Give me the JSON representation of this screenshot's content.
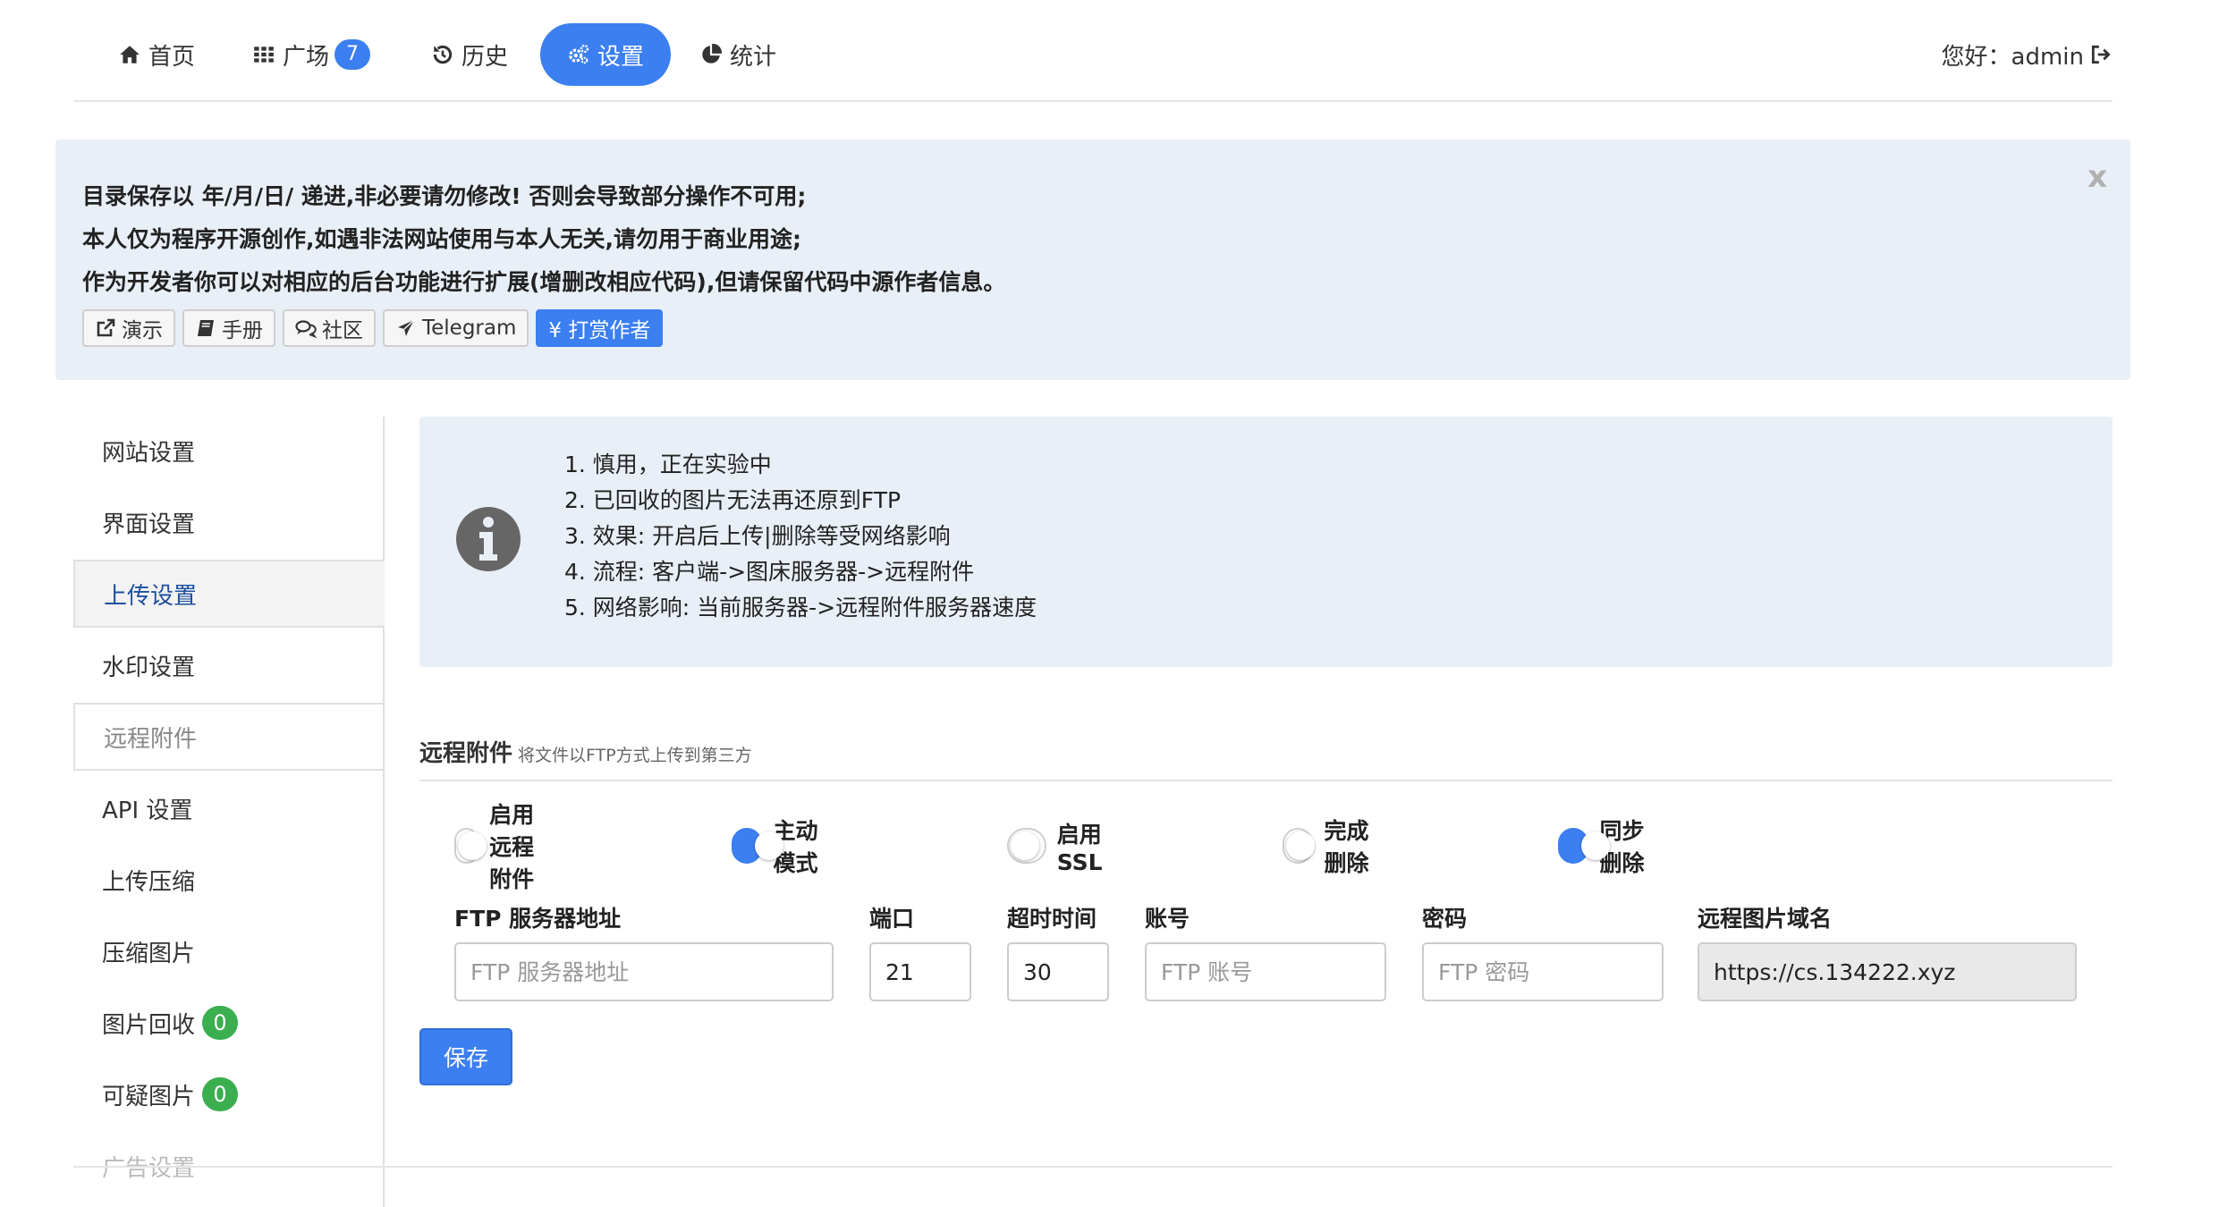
{
  "nav": {
    "items": [
      {
        "label": "首页",
        "icon": "home-icon"
      },
      {
        "label": "广场",
        "icon": "grid-icon",
        "badge": "7"
      },
      {
        "label": "历史",
        "icon": "history-icon"
      },
      {
        "label": "设置",
        "icon": "gears-icon",
        "active": true
      },
      {
        "label": "统计",
        "icon": "pie-chart-icon"
      }
    ],
    "greeting": "您好：admin",
    "accent_color": "#3b7ff0"
  },
  "notice": {
    "lines": [
      "目录保存以 年/月/日/ 递进,非必要请勿修改! 否则会导致部分操作不可用;",
      "本人仅为程序开源创作,如遇非法网站使用与本人无关,请勿用于商业用途;",
      "作为开发者你可以对相应的后台功能进行扩展(增删改相应代码),但请保留代码中源作者信息。"
    ],
    "close": "x",
    "buttons": [
      {
        "label": "演示",
        "icon": "external-link-icon"
      },
      {
        "label": "手册",
        "icon": "book-icon"
      },
      {
        "label": "社区",
        "icon": "comments-icon"
      },
      {
        "label": "Telegram",
        "icon": "plane-icon"
      },
      {
        "label": "¥ 打赏作者",
        "icon": ""
      }
    ]
  },
  "sidebar": {
    "items": [
      {
        "label": "网站设置"
      },
      {
        "label": "界面设置"
      },
      {
        "label": "上传设置",
        "state": "active"
      },
      {
        "label": "水印设置"
      },
      {
        "label": "远程附件",
        "state": "hovered"
      },
      {
        "label": "API 设置"
      },
      {
        "label": "上传压缩"
      },
      {
        "label": "压缩图片"
      },
      {
        "label": "图片回收",
        "badge": "0"
      },
      {
        "label": "可疑图片",
        "badge": "0"
      },
      {
        "label": "广告设置",
        "state": "faded"
      }
    ],
    "badge_color": "#3bae4f"
  },
  "info": {
    "icon": "info-icon",
    "lines": [
      "1. 慎用，正在实验中",
      "2. 已回收的图片无法再还原到FTP",
      "3. 效果: 开启后上传|删除等受网络影响",
      "4. 流程: 客户端->图床服务器->远程附件",
      "5. 网络影响: 当前服务器->远程附件服务器速度"
    ]
  },
  "section": {
    "title": "远程附件",
    "subtitle": "将文件以FTP方式上传到第三方"
  },
  "toggles": [
    {
      "label": "启用远程附件",
      "on": false
    },
    {
      "label": "主动模式",
      "on": true
    },
    {
      "label": "启用SSL",
      "on": false
    },
    {
      "label": "完成删除",
      "on": false
    },
    {
      "label": "同步删除",
      "on": true
    }
  ],
  "fields": [
    {
      "label": "FTP 服务器地址",
      "value": "",
      "placeholder": "FTP 服务器地址"
    },
    {
      "label": "端口",
      "value": "21",
      "placeholder": ""
    },
    {
      "label": "超时时间",
      "value": "30",
      "placeholder": ""
    },
    {
      "label": "账号",
      "value": "",
      "placeholder": "FTP 账号"
    },
    {
      "label": "密码",
      "value": "",
      "placeholder": "FTP 密码"
    },
    {
      "label": "远程图片域名",
      "value": "https://cs.134222.xyz",
      "placeholder": "",
      "readonly": true
    }
  ],
  "save_label": "保存"
}
